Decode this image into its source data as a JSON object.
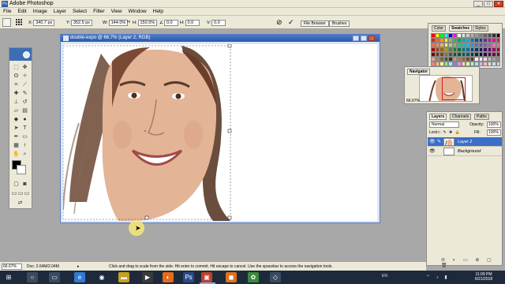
{
  "app": {
    "title": "Adobe Photoshop",
    "window_controls": [
      "_",
      "□",
      "✕"
    ]
  },
  "menu": [
    "File",
    "Edit",
    "Image",
    "Layer",
    "Select",
    "Filter",
    "View",
    "Window",
    "Help"
  ],
  "options_bar": {
    "x_label": "X:",
    "x_value": "340.7 px",
    "y_label": "Y:",
    "y_value": "352.5 px",
    "w_label": "W:",
    "w_value": "144.0%",
    "h_label": "H:",
    "h_value": "150.5%",
    "angle_value": "0.0",
    "h_skew_label": "H:",
    "h_skew_value": "0.0",
    "v_skew_label": "V:",
    "v_skew_value": "0.0",
    "cancel_glyph": "⊘",
    "commit_glyph": "✓",
    "file_browser_tab": "File Browser",
    "brushes_tab": "Brushes"
  },
  "document": {
    "title": "double-expo @ 66.7% (Layer 2, RGB)"
  },
  "swatches": {
    "tabs": [
      "Color",
      "Swatches",
      "Styles"
    ],
    "colors": [
      "#ff0000",
      "#ffff00",
      "#00ff00",
      "#00ffff",
      "#0000ff",
      "#ff00ff",
      "#ffffff",
      "#e6e6e6",
      "#cccccc",
      "#b3b3b3",
      "#999999",
      "#808080",
      "#666666",
      "#4d4d4d",
      "#333333",
      "#000000",
      "#ed1c24",
      "#f26522",
      "#f7941d",
      "#fff200",
      "#8dc63f",
      "#39b54a",
      "#00a651",
      "#00a99d",
      "#00aeef",
      "#0072bc",
      "#0054a6",
      "#2e3192",
      "#662d91",
      "#92278f",
      "#ec008c",
      "#ed145b",
      "#f26c4f",
      "#f68e55",
      "#fbaf5c",
      "#fff467",
      "#acd372",
      "#7cc576",
      "#3bb878",
      "#1abbb4",
      "#00bff3",
      "#438ccb",
      "#5574b9",
      "#605ca8",
      "#855fa8",
      "#a763a8",
      "#f06ea9",
      "#f26d7d",
      "#9e0b0f",
      "#a0410d",
      "#a3620a",
      "#aba000",
      "#598527",
      "#197b30",
      "#007236",
      "#00746b",
      "#0076a3",
      "#004a80",
      "#003471",
      "#1b1464",
      "#440e62",
      "#630460",
      "#9e005d",
      "#9e0039",
      "#790000",
      "#7b2e00",
      "#7d4900",
      "#827b00",
      "#406618",
      "#005e20",
      "#005826",
      "#005952",
      "#005b7f",
      "#003663",
      "#002157",
      "#0d004c",
      "#32004b",
      "#4b0049",
      "#7b0046",
      "#7a0026",
      "#c7b299",
      "#998675",
      "#736357",
      "#534741",
      "#37302a",
      "#c69c6d",
      "#a67c52",
      "#8c6239",
      "#754c24",
      "#603913",
      "#ffffff",
      "#f2f2f2",
      "#e0e0e0",
      "#bdbdbd",
      "#a0a0a0",
      "#8a8a8a",
      "#ff8080",
      "#ffbf80",
      "#ffff80",
      "#80ff80",
      "#80ffff",
      "#8080ff",
      "#ff80ff",
      "#ffd9b3",
      "#d9ffb3",
      "#b3ffd9",
      "#b3d9ff",
      "#d9b3ff",
      "#ffb3d9",
      "#f0e0c0",
      "#c0e0f0",
      "#e0c0f0"
    ]
  },
  "navigator": {
    "title": "Navigator",
    "zoom": "66.67%"
  },
  "layers": {
    "tabs": [
      "Layers",
      "Channels",
      "Paths"
    ],
    "blend_mode": "Normal",
    "opacity_label": "Opacity:",
    "opacity_value": "100%",
    "lock_label": "Lock:",
    "fill_label": "Fill:",
    "fill_value": "100%",
    "items": [
      {
        "name": "Layer 2",
        "selected": true
      },
      {
        "name": "Background",
        "selected": false
      }
    ]
  },
  "status": {
    "zoom": "66.67%",
    "doc": "Doc: 2.64M/2.04M",
    "hint": "Click and drag to scale from the side. Hit enter to commit. Hit escape to cancel. Use the spacebar to access the navigation tools."
  },
  "taskbar": {
    "lang": "EN",
    "time": "11:09 PM",
    "date": "6/21/2018"
  },
  "colors": {
    "title_bar_blue": "#2a5aa8",
    "selected_layer": "#3a6ec8",
    "taskbar": "#1e2a3c"
  }
}
